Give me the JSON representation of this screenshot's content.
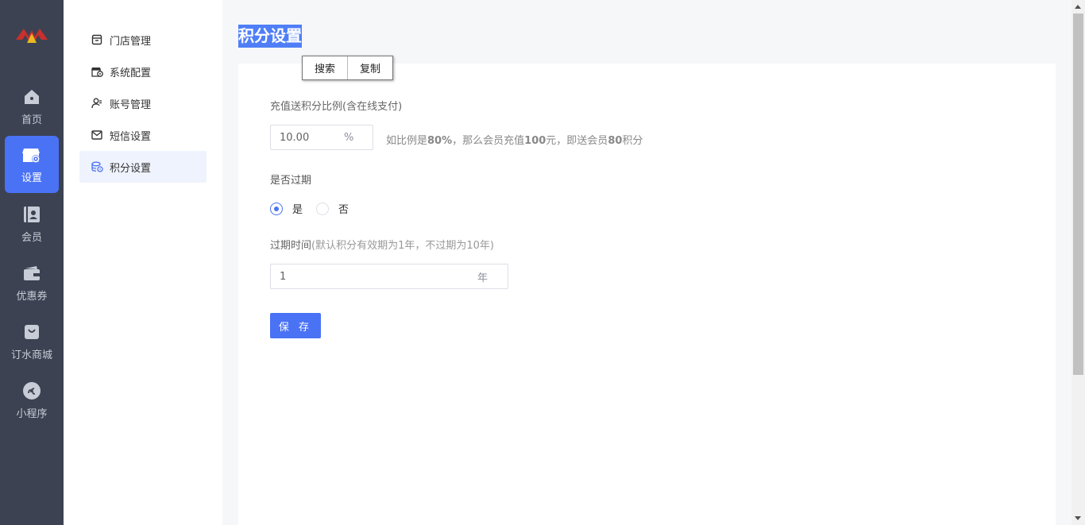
{
  "nav": {
    "items": [
      {
        "label": "首页",
        "icon": "home-icon"
      },
      {
        "label": "设置",
        "icon": "store-settings-icon",
        "active": true
      },
      {
        "label": "会员",
        "icon": "member-icon"
      },
      {
        "label": "优惠券",
        "icon": "wallet-icon"
      },
      {
        "label": "订水商城",
        "icon": "shopping-bag-icon"
      },
      {
        "label": "小程序",
        "icon": "mini-program-icon"
      }
    ]
  },
  "submenu": {
    "items": [
      {
        "label": "门店管理",
        "icon": "store-icon"
      },
      {
        "label": "系统配置",
        "icon": "system-config-icon"
      },
      {
        "label": "账号管理",
        "icon": "account-icon"
      },
      {
        "label": "短信设置",
        "icon": "mail-icon"
      },
      {
        "label": "积分设置",
        "icon": "points-icon",
        "active": true
      }
    ]
  },
  "page": {
    "title": "积分设置"
  },
  "context_menu": {
    "search": "搜索",
    "copy": "复制"
  },
  "form": {
    "ratio_label": "充值送积分比例(含在线支付)",
    "ratio_value": "10.00",
    "ratio_unit": "%",
    "ratio_tip_prefix": "如比例是",
    "ratio_tip_pct": "80%",
    "ratio_tip_mid": "，那么会员充值",
    "ratio_tip_amount": "100",
    "ratio_tip_mid2": "元，即送会员",
    "ratio_tip_points": "80",
    "ratio_tip_suffix": "积分",
    "expire_label": "是否过期",
    "expire_yes": "是",
    "expire_no": "否",
    "expire_selected": "是",
    "expire_time_label": "过期时间",
    "expire_time_hint": "(默认积分有效期为1年，不过期为10年)",
    "expire_time_value": "1",
    "expire_time_unit": "年",
    "save_label": "保 存"
  },
  "colors": {
    "nav_bg": "#3c4252",
    "accent": "#4a72f5",
    "submenu_active_bg": "#eff3fd"
  }
}
